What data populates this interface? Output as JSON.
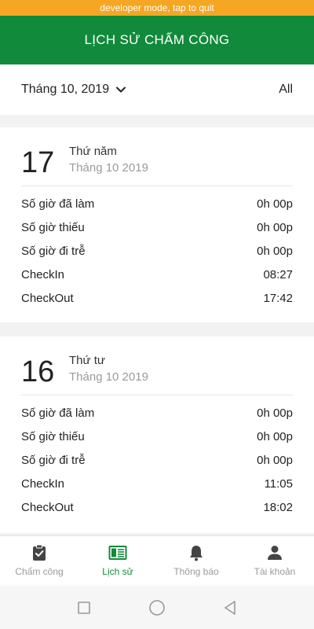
{
  "dev_banner": "developer mode, tap to quit",
  "header": {
    "title": "LỊCH SỬ CHẤM CÔNG"
  },
  "filter": {
    "month": "Tháng 10, 2019",
    "all_label": "All"
  },
  "records": [
    {
      "day": "17",
      "weekday": "Thứ năm",
      "month_year": "Tháng 10 2019",
      "rows": [
        {
          "label": "Số giờ đã làm",
          "value": "0h 00p"
        },
        {
          "label": "Số giờ thiếu",
          "value": "0h 00p"
        },
        {
          "label": "Số giờ đi trễ",
          "value": "0h 00p"
        },
        {
          "label": "CheckIn",
          "value": "08:27"
        },
        {
          "label": "CheckOut",
          "value": "17:42"
        }
      ]
    },
    {
      "day": "16",
      "weekday": "Thứ tư",
      "month_year": "Tháng 10 2019",
      "rows": [
        {
          "label": "Số giờ đã làm",
          "value": "0h 00p"
        },
        {
          "label": "Số giờ thiếu",
          "value": "0h 00p"
        },
        {
          "label": "Số giờ đi trễ",
          "value": "0h 00p"
        },
        {
          "label": "CheckIn",
          "value": "11:05"
        },
        {
          "label": "CheckOut",
          "value": "18:02"
        }
      ]
    }
  ],
  "bottom_nav": [
    {
      "label": "Chấm công",
      "icon": "clipboard-check-icon",
      "active": false
    },
    {
      "label": "Lịch sử",
      "icon": "history-list-icon",
      "active": true
    },
    {
      "label": "Thông báo",
      "icon": "bell-icon",
      "active": false
    },
    {
      "label": "Tài khoản",
      "icon": "person-icon",
      "active": false
    }
  ],
  "colors": {
    "primary": "#118a3b",
    "dev_banner": "#f5a623",
    "inactive": "#9a9a9a"
  }
}
